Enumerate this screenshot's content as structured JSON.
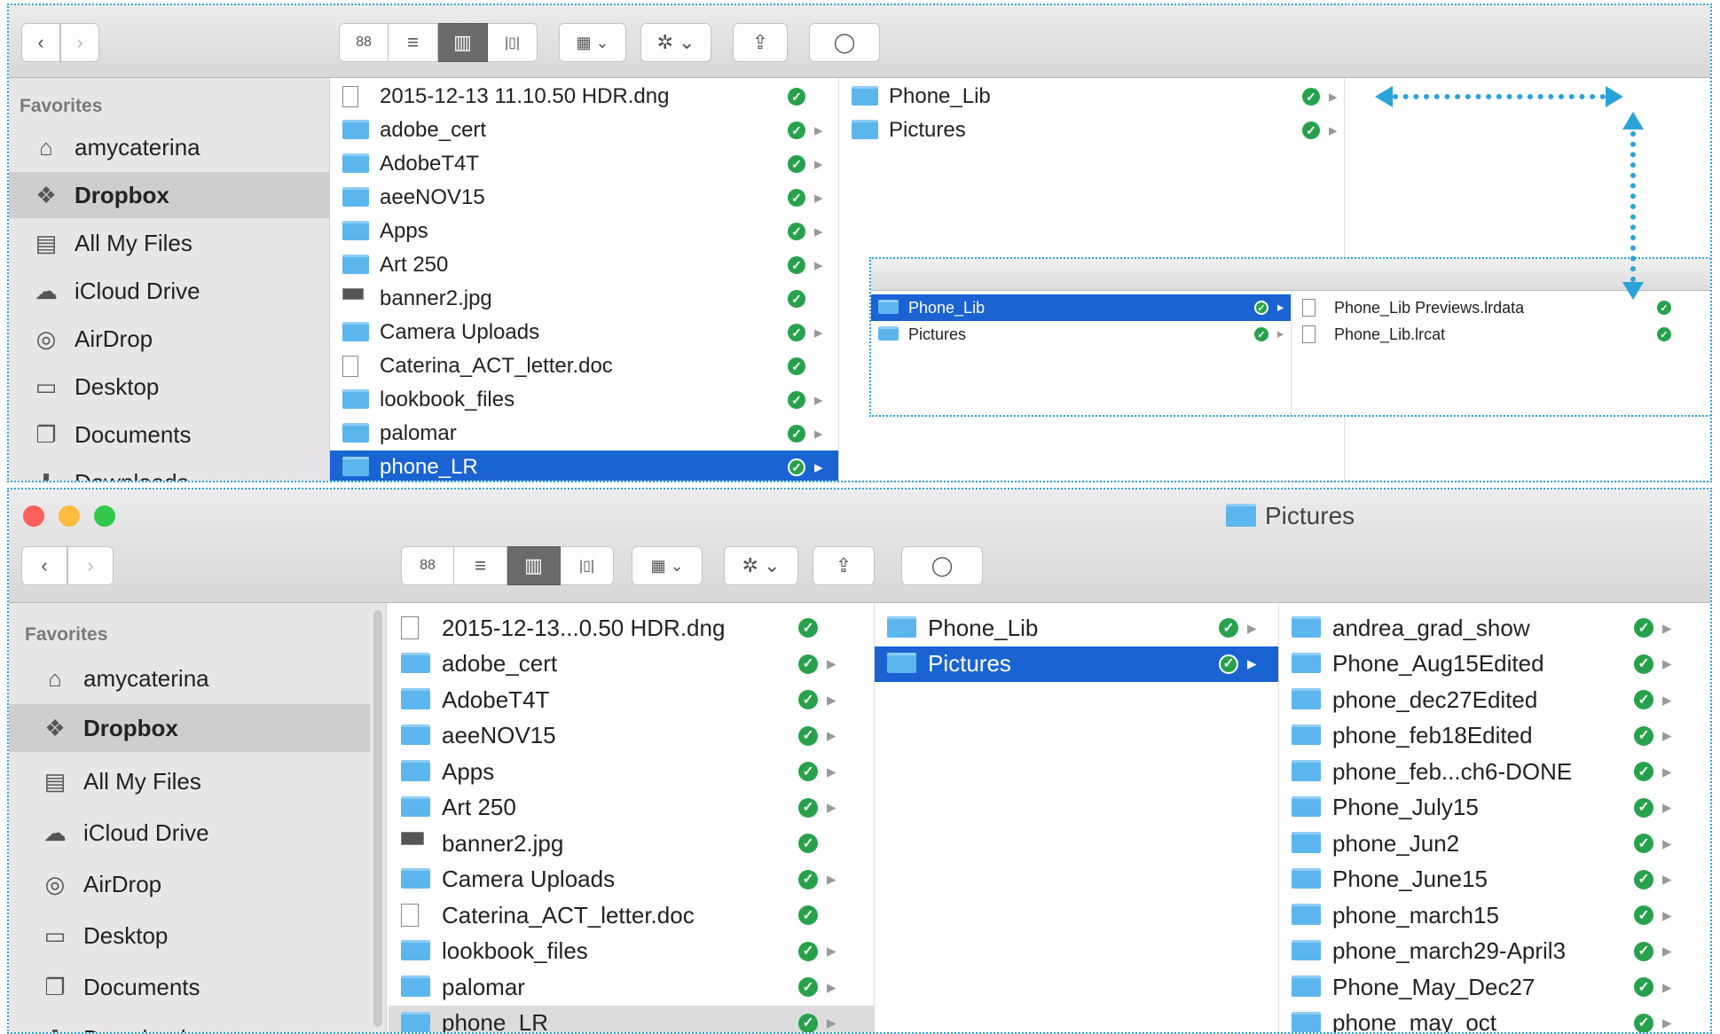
{
  "toolbar": {
    "icon_view": "88",
    "list_view": "≡",
    "column_view": "▥",
    "gallery_view": "|▯|",
    "arrange": "▦ ⌄",
    "action": "✲ ⌄",
    "share": "⇪",
    "tag": "◯"
  },
  "sidebar": {
    "header": "Favorites",
    "items": [
      {
        "label": "amycaterina",
        "icon": "home-icon"
      },
      {
        "label": "Dropbox",
        "icon": "dropbox-icon"
      },
      {
        "label": "All My Files",
        "icon": "all-files-icon"
      },
      {
        "label": "iCloud Drive",
        "icon": "cloud-icon"
      },
      {
        "label": "AirDrop",
        "icon": "airdrop-icon"
      },
      {
        "label": "Desktop",
        "icon": "desktop-icon"
      },
      {
        "label": "Documents",
        "icon": "documents-icon"
      },
      {
        "label": "Downloads",
        "icon": "downloads-icon"
      }
    ]
  },
  "top": {
    "col1": [
      {
        "name": "2015-12-13 11.10.50 HDR.dng",
        "arrow": false
      },
      {
        "name": "adobe_cert",
        "arrow": true
      },
      {
        "name": "AdobeT4T",
        "arrow": true
      },
      {
        "name": "aeeNOV15",
        "arrow": true
      },
      {
        "name": "Apps",
        "arrow": true
      },
      {
        "name": "Art 250",
        "arrow": true
      },
      {
        "name": "banner2.jpg",
        "arrow": false
      },
      {
        "name": "Camera Uploads",
        "arrow": true
      },
      {
        "name": "Caterina_ACT_letter.doc",
        "arrow": false
      },
      {
        "name": "lookbook_files",
        "arrow": true
      },
      {
        "name": "palomar",
        "arrow": true
      },
      {
        "name": "phone_LR",
        "arrow": true
      }
    ],
    "col2": [
      {
        "name": "Phone_Lib"
      },
      {
        "name": "Pictures"
      }
    ],
    "inset_col1": [
      {
        "name": "Phone_Lib"
      },
      {
        "name": "Pictures"
      }
    ],
    "inset_col2": [
      {
        "name": "Phone_Lib Previews.lrdata"
      },
      {
        "name": "Phone_Lib.lrcat"
      }
    ]
  },
  "bottom": {
    "window_title": "Pictures",
    "col1": [
      {
        "name": "2015-12-13...0.50 HDR.dng",
        "arrow": false
      },
      {
        "name": "adobe_cert",
        "arrow": true
      },
      {
        "name": "AdobeT4T",
        "arrow": true
      },
      {
        "name": "aeeNOV15",
        "arrow": true
      },
      {
        "name": "Apps",
        "arrow": true
      },
      {
        "name": "Art 250",
        "arrow": true
      },
      {
        "name": "banner2.jpg",
        "arrow": false
      },
      {
        "name": "Camera Uploads",
        "arrow": true
      },
      {
        "name": "Caterina_ACT_letter.doc",
        "arrow": false
      },
      {
        "name": "lookbook_files",
        "arrow": true
      },
      {
        "name": "palomar",
        "arrow": true
      },
      {
        "name": "phone_LR",
        "arrow": true
      }
    ],
    "col2": [
      {
        "name": "Phone_Lib"
      },
      {
        "name": "Pictures"
      }
    ],
    "col3": [
      {
        "name": "andrea_grad_show"
      },
      {
        "name": "Phone_Aug15Edited"
      },
      {
        "name": "phone_dec27Edited"
      },
      {
        "name": "phone_feb18Edited"
      },
      {
        "name": "phone_feb...ch6-DONE"
      },
      {
        "name": "Phone_July15"
      },
      {
        "name": "phone_Jun2"
      },
      {
        "name": "Phone_June15"
      },
      {
        "name": "phone_march15"
      },
      {
        "name": "phone_march29-April3"
      },
      {
        "name": "Phone_May_Dec27"
      },
      {
        "name": "phone_may_oct"
      }
    ]
  },
  "colors": {
    "selection": "#1a63d3",
    "sync_check": "#27a24b",
    "folder": "#5cb6ee",
    "annotation": "#2aa3d8"
  }
}
